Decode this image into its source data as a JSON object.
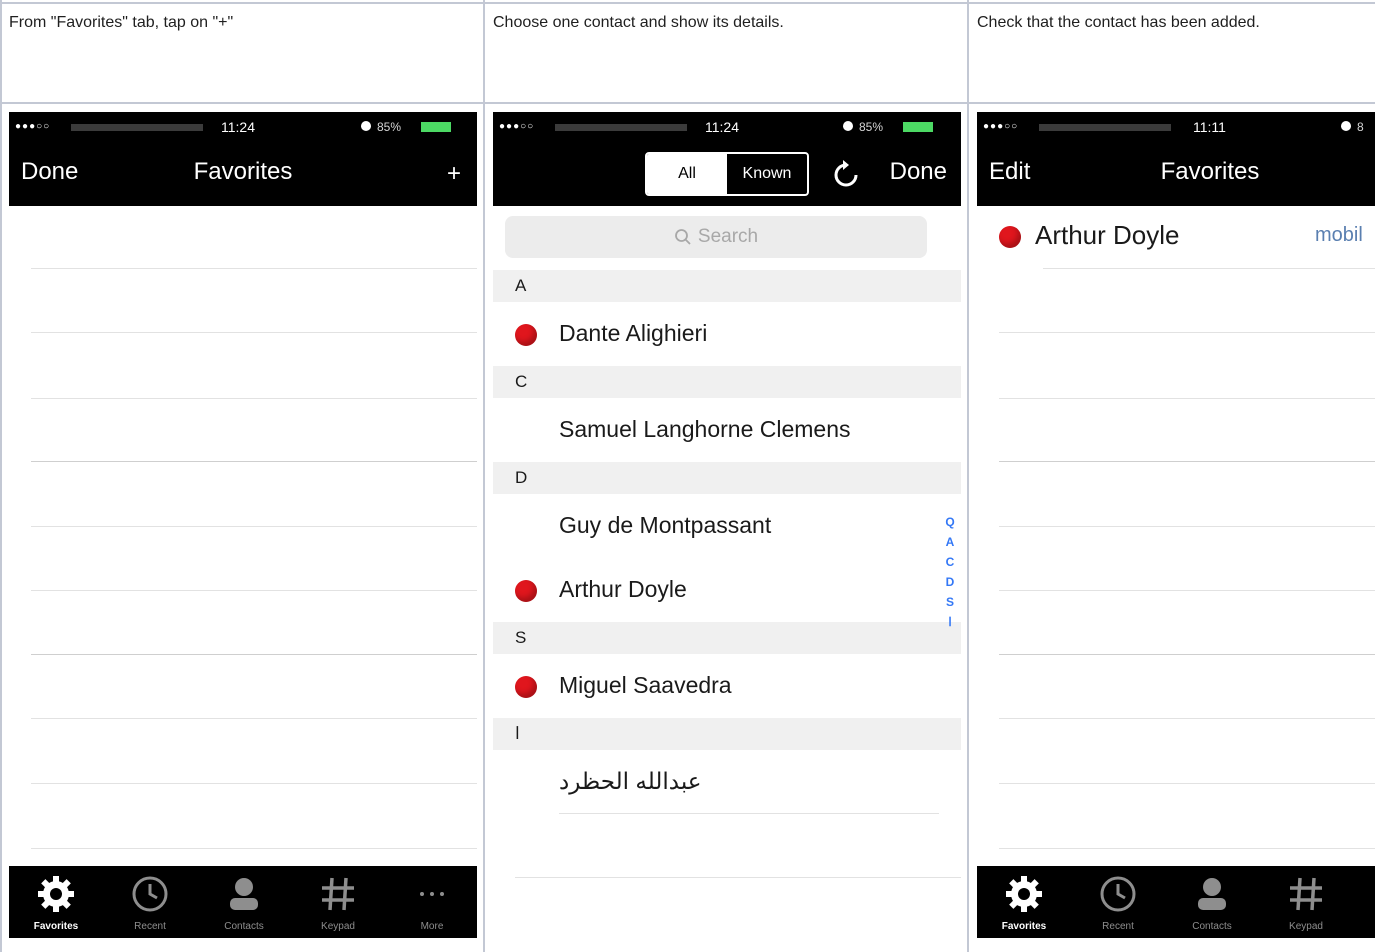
{
  "captions": [
    "From \"Favorites\" tab, tap on \"+\"",
    "Choose one contact and show its details.",
    "Check that the contact has been added."
  ],
  "screen1": {
    "status_time": "11:24",
    "battery": "85%",
    "nav_left": "Done",
    "nav_title": "Favorites",
    "nav_right": "+"
  },
  "screen2": {
    "status_time": "11:24",
    "battery": "85%",
    "segments": [
      "All",
      "Known"
    ],
    "nav_right": "Done",
    "search_placeholder": "Search",
    "sections": [
      {
        "letter": "A",
        "contacts": [
          {
            "name": "Dante Alighieri",
            "favorite": true
          }
        ]
      },
      {
        "letter": "C",
        "contacts": [
          {
            "name": "Samuel Langhorne Clemens",
            "favorite": false
          }
        ]
      },
      {
        "letter": "D",
        "contacts": [
          {
            "name": "Guy de Montpassant",
            "favorite": false
          },
          {
            "name": "Arthur Doyle",
            "favorite": true
          }
        ]
      },
      {
        "letter": "S",
        "contacts": [
          {
            "name": "Miguel Saavedra",
            "favorite": true
          }
        ]
      },
      {
        "letter": "ا",
        "contacts": [
          {
            "name": "عبدالله الحظرد",
            "favorite": false
          }
        ]
      }
    ],
    "index": [
      "Q",
      "A",
      "C",
      "D",
      "S",
      "ا"
    ]
  },
  "screen3": {
    "status_time": "11:11",
    "battery": "8",
    "nav_left": "Edit",
    "nav_title": "Favorites",
    "favorite_name": "Arthur Doyle",
    "favorite_type": "mobil"
  },
  "tabbar": {
    "tabs": [
      "Favorites",
      "Recent",
      "Contacts",
      "Keypad",
      "More"
    ]
  },
  "colors": {
    "bar": "#000000",
    "favorite_dot": "#e0161d",
    "link_blue": "#3478f6",
    "battery_green": "#4cd964"
  }
}
